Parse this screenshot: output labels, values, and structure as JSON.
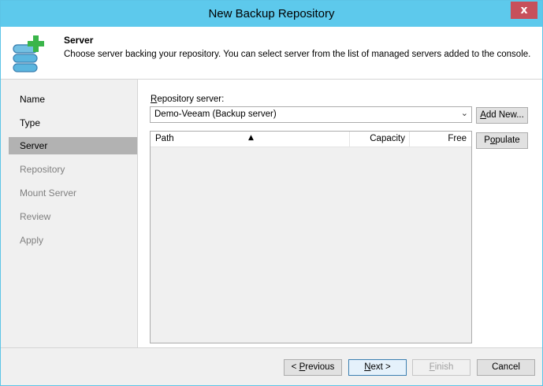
{
  "window": {
    "title": "New Backup Repository",
    "close_glyph": "x"
  },
  "header": {
    "title": "Server",
    "description": "Choose server backing your repository. You can select server from the list of managed servers added to the console.",
    "icon": "database-add-icon"
  },
  "nav": {
    "items": [
      {
        "label": "Name",
        "state": "done"
      },
      {
        "label": "Type",
        "state": "done"
      },
      {
        "label": "Server",
        "state": "active"
      },
      {
        "label": "Repository",
        "state": "future"
      },
      {
        "label": "Mount Server",
        "state": "future"
      },
      {
        "label": "Review",
        "state": "future"
      },
      {
        "label": "Apply",
        "state": "future"
      }
    ]
  },
  "main": {
    "repo_label_mnemonic": "R",
    "repo_label_rest": "epository server:",
    "repo_server_value": "Demo-Veeam (Backup server)",
    "add_new": {
      "mnemonic": "A",
      "rest": "dd New..."
    },
    "populate": {
      "pre": "P",
      "mnemonic": "o",
      "rest": "pulate"
    },
    "columns": [
      "Path",
      "Capacity",
      "Free"
    ]
  },
  "footer": {
    "previous": {
      "pre": "< ",
      "mnemonic": "P",
      "rest": "revious"
    },
    "next": {
      "mnemonic": "N",
      "rest": "ext >"
    },
    "finish": {
      "mnemonic": "F",
      "rest": "inish"
    },
    "cancel": "Cancel"
  },
  "colors": {
    "titlebar": "#5dc9ec",
    "close": "#c7505b",
    "nav_active": "#b2b2b2",
    "icon_green": "#3ab54a",
    "icon_blue": "#5bb6df"
  }
}
